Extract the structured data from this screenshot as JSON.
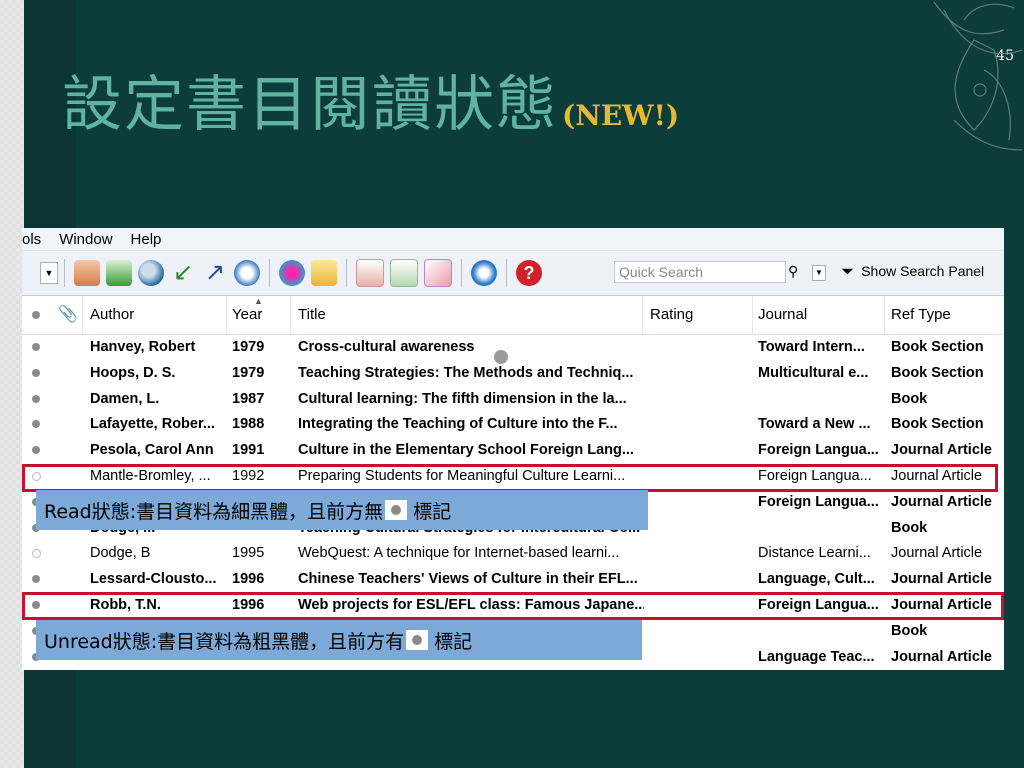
{
  "slide": {
    "title": "設定書目閱讀狀態",
    "title_suffix": "(NEW!)",
    "page_number": "45"
  },
  "menu": [
    "ols",
    "Window",
    "Help"
  ],
  "toolbar": {
    "quick_search_placeholder": "Quick Search",
    "show_search_panel": "Show Search Panel",
    "icons": [
      "copy-references-icon",
      "new-reference-icon",
      "find-fulltext-icon",
      "import-icon",
      "export-icon",
      "web-icon",
      "online-search-icon",
      "folder-icon",
      "insert-citation-icon",
      "format-bibliography-icon",
      "edit-citation-icon",
      "sync-icon",
      "help-icon"
    ]
  },
  "columns": {
    "author": "Author",
    "year": "Year",
    "title": "Title",
    "rating": "Rating",
    "journal": "Journal",
    "ref_type": "Ref Type"
  },
  "rows": [
    {
      "status": "unread",
      "author": "Hanvey, Robert",
      "year": "1979",
      "title": "Cross-cultural awareness",
      "journal": "Toward Intern...",
      "ref_type": "Book Section"
    },
    {
      "status": "unread",
      "author": "Hoops, D. S.",
      "year": "1979",
      "title": "Teaching Strategies: The Methods and Techniq...",
      "journal": "Multicultural e...",
      "ref_type": "Book Section"
    },
    {
      "status": "unread",
      "author": "Damen, L.",
      "year": "1987",
      "title": "Cultural learning: The fifth dimension in the la...",
      "journal": "",
      "ref_type": "Book"
    },
    {
      "status": "unread",
      "author": "Lafayette, Rober...",
      "year": "1988",
      "title": "Integrating the Teaching of Culture into the F...",
      "journal": "Toward a New ...",
      "ref_type": "Book Section"
    },
    {
      "status": "unread",
      "author": "Pesola, Carol Ann",
      "year": "1991",
      "title": "Culture in the Elementary School Foreign Lang...",
      "journal": "Foreign Langua...",
      "ref_type": "Journal Article"
    },
    {
      "status": "read",
      "author": "Mantle-Bromley, ...",
      "year": "1992",
      "title": "Preparing Students for Meaningful Culture Learni...",
      "journal": "Foreign Langua...",
      "ref_type": "Journal Article"
    },
    {
      "status": "unread",
      "author": "",
      "year": "",
      "title": "",
      "journal": "Foreign Langua...",
      "ref_type": "Journal Article"
    },
    {
      "status": "unread",
      "author": "Dodge, ...",
      "year": "",
      "title": "Teaching Cultural Strategies for Intercultural Co...",
      "journal": "",
      "ref_type": "Book"
    },
    {
      "status": "read",
      "author": "Dodge, B",
      "year": "1995",
      "title": "WebQuest: A technique for Internet-based learni...",
      "journal": "Distance Learni...",
      "ref_type": "Journal Article"
    },
    {
      "status": "unread",
      "author": "Lessard-Clousto...",
      "year": "1996",
      "title": "Chinese Teachers' Views of Culture in their EFL...",
      "journal": "Language, Cult...",
      "ref_type": "Journal Article"
    },
    {
      "status": "unread",
      "author": "Robb, T.N.",
      "year": "1996",
      "title": "Web projects for ESL/EFL class: Famous Japane...",
      "journal": "Foreign Langua...",
      "ref_type": "Journal Article"
    },
    {
      "status": "unread",
      "author": "",
      "year": "",
      "title": "",
      "journal": "",
      "ref_type": "Book"
    },
    {
      "status": "unread",
      "author": "",
      "year": "",
      "title": "",
      "journal": "Language Teac...",
      "ref_type": "Journal Article"
    }
  ],
  "callouts": {
    "read_before": "Read狀態:書目資料為細黑體，且前方無",
    "read_after": "標記",
    "unread_before": "Unread狀態:書目資料為粗黑體，且前方有",
    "unread_after": "標記"
  },
  "colors": {
    "background": "#0d3d3b",
    "title": "#5fb3a0",
    "title_suffix": "#e8b830",
    "highlight_border": "#c8102e",
    "callout_bg": "#7da9d8",
    "read_dot": "#8a8a8a"
  }
}
